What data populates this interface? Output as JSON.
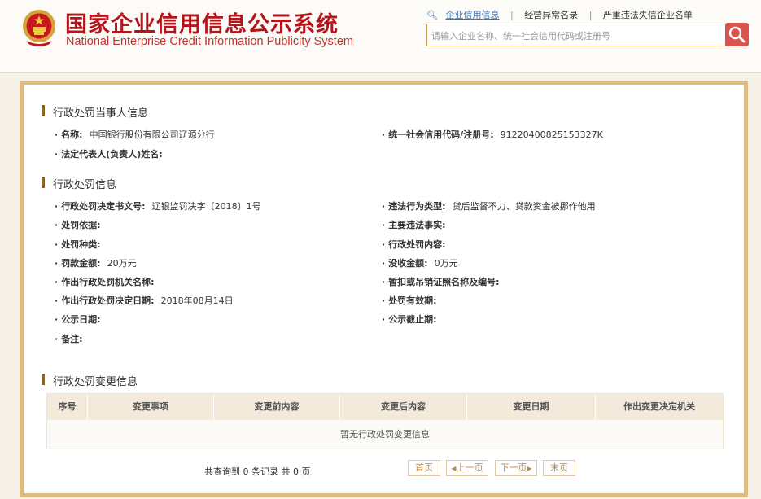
{
  "header": {
    "title_cn": "国家企业信用信息公示系统",
    "title_en": "National Enterprise Credit Information Publicity System",
    "nav": [
      "企业信用信息",
      "经营异常名录",
      "严重违法失信企业名单"
    ],
    "search_placeholder": "请输入企业名称、统一社会信用代码或注册号"
  },
  "party": {
    "title": "行政处罚当事人信息",
    "name_label": "名称:",
    "name_value": "中国银行股份有限公司辽源分行",
    "code_label": "统一社会信用代码/注册号:",
    "code_value": "91220400825153327K",
    "rep_label": "法定代表人(负责人)姓名:"
  },
  "penalty": {
    "title": "行政处罚信息",
    "doc_label": "行政处罚决定书文号:",
    "doc_value": "辽银监罚决字〔2018〕1号",
    "violation_type_label": "违法行为类型:",
    "violation_type_value": "贷后监督不力、贷款资金被挪作他用",
    "basis_label": "处罚依据:",
    "main_facts_label": "主要违法事实:",
    "kind_label": "处罚种类:",
    "content_label": "行政处罚内容:",
    "fine_label": "罚款金额:",
    "fine_value": "20万元",
    "confiscate_label": "没收金额:",
    "confiscate_value": "0万元",
    "authority_label": "作出行政处罚机关名称:",
    "license_label": "暂扣或吊销证照名称及编号:",
    "decision_date_label": "作出行政处罚决定日期:",
    "decision_date_value": "2018年08月14日",
    "validity_label": "处罚有效期:",
    "publish_date_label": "公示日期:",
    "publish_end_label": "公示截止期:",
    "remark_label": "备注:"
  },
  "changes": {
    "title": "行政处罚变更信息",
    "columns": [
      "序号",
      "变更事项",
      "变更前内容",
      "变更后内容",
      "变更日期",
      "作出变更决定机关"
    ],
    "empty_text": "暂无行政处罚变更信息",
    "pager_info": "共查询到 0 条记录 共 0 页",
    "first": "首页",
    "prev": "上一页",
    "next": "下一页",
    "last": "末页"
  }
}
